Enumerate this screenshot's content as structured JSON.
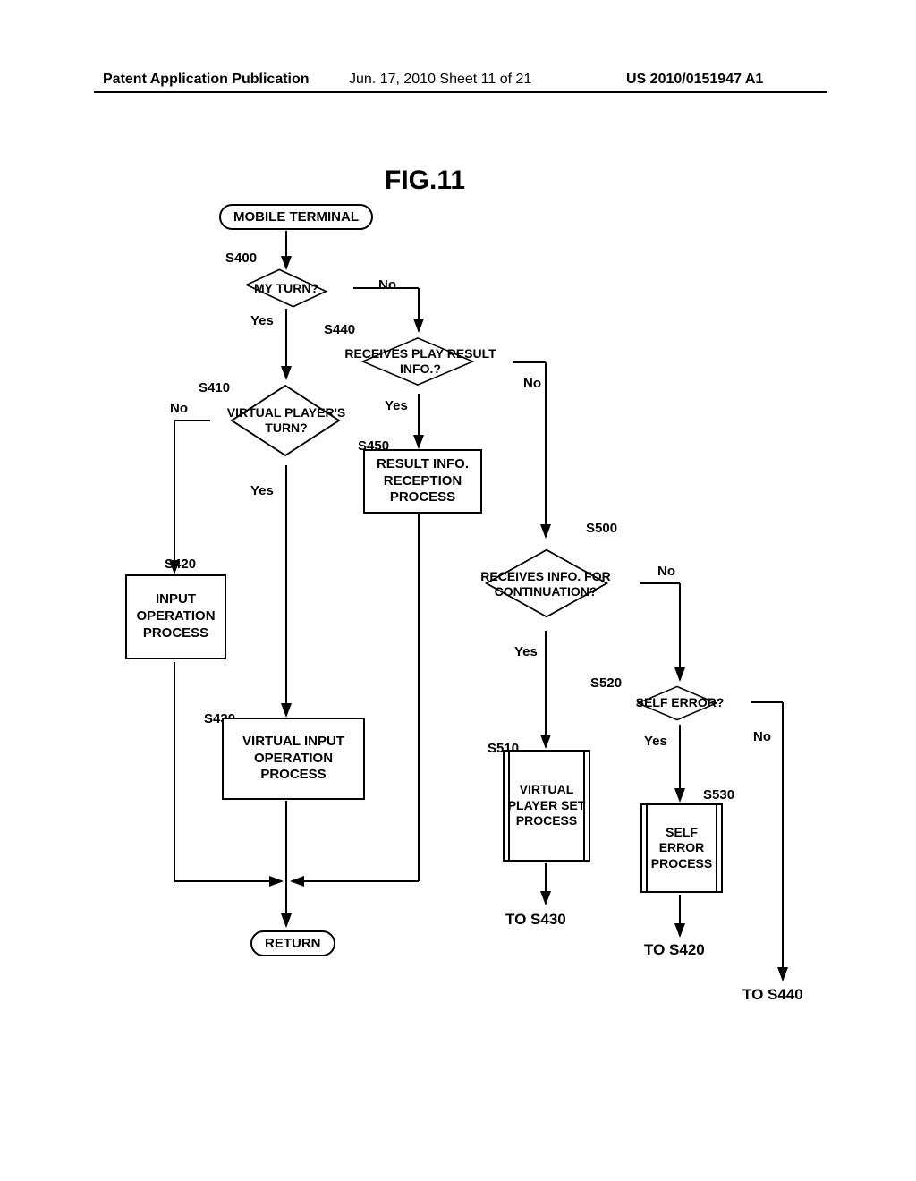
{
  "header": {
    "left": "Patent Application Publication",
    "mid": "Jun. 17, 2010  Sheet 11 of 21",
    "right": "US 2010/0151947 A1"
  },
  "figure_title": "FIG.11",
  "nodes": {
    "start": "MOBILE  TERMINAL",
    "s400_label": "S400",
    "s400_text": "MY TURN?",
    "s410_label": "S410",
    "s410_text": "VIRTUAL PLAYER'S TURN?",
    "s420_label": "S420",
    "s420_text": "INPUT OPERATION PROCESS",
    "s430_label": "S430",
    "s430_text": "VIRTUAL  INPUT OPERATION PROCESS",
    "s440_label": "S440",
    "s440_text": "RECEIVES  PLAY RESULT  INFO.?",
    "s450_label": "S450",
    "s450_text": "RESULT  INFO. RECEPTION PROCESS",
    "s500_label": "S500",
    "s500_text": "RECEIVES  INFO. FOR CONTINUATION?",
    "s510_label": "S510",
    "s510_text": "VIRTUAL PLAYER SET PROCESS",
    "s520_label": "S520",
    "s520_text": "SELF ERROR?",
    "s530_label": "S530",
    "s530_text": "SELF ERROR PROCESS",
    "return": "RETURN"
  },
  "edges": {
    "yes": "Yes",
    "no": "No"
  },
  "offpage": {
    "to_s430": "TO  S430",
    "to_s420": "TO  S420",
    "to_s440": "TO  S440"
  }
}
